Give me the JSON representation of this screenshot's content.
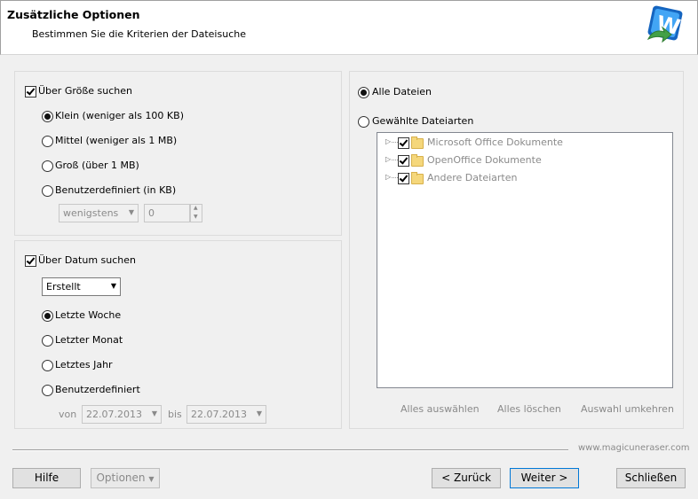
{
  "header": {
    "title": "Zusätzliche Optionen",
    "subtitle": "Bestimmen Sie die Kriterien der Dateisuche",
    "logo_icon": "magic-uneraser-logo-icon"
  },
  "size_group": {
    "checkbox_label": "Über Größe suchen",
    "checked": true,
    "options": [
      {
        "label": "Klein (weniger als 100 KB)",
        "selected": true
      },
      {
        "label": "Mittel (weniger als 1 MB)",
        "selected": false
      },
      {
        "label": "Groß (über 1 MB)",
        "selected": false
      },
      {
        "label": "Benutzerdefiniert (in KB)",
        "selected": false
      }
    ],
    "mode_select_value": "wenigstens",
    "size_value": "0"
  },
  "date_group": {
    "checkbox_label": "Über Datum suchen",
    "checked": true,
    "type_select_value": "Erstellt",
    "options": [
      {
        "label": "Letzte Woche",
        "selected": true
      },
      {
        "label": "Letzter Monat",
        "selected": false
      },
      {
        "label": "Letztes Jahr",
        "selected": false
      },
      {
        "label": "Benutzerdefiniert",
        "selected": false
      }
    ],
    "from_label": "von",
    "from_value": "22.07.2013",
    "to_label": "bis",
    "to_value": "22.07.2013"
  },
  "file_group": {
    "all_files_label": "Alle Dateien",
    "selected_types_label": "Gewählte Dateiarten",
    "tree_items": [
      {
        "label": "Microsoft Office Dokumente",
        "checked": true
      },
      {
        "label": "OpenOffice Dokumente",
        "checked": true
      },
      {
        "label": "Andere Dateiarten",
        "checked": true
      }
    ],
    "select_all_label": "Alles auswählen",
    "clear_all_label": "Alles löschen",
    "invert_label": "Auswahl umkehren"
  },
  "footer": {
    "website": "www.magicuneraser.com",
    "help_label": "Hilfe",
    "options_label": "Optionen",
    "back_label": "< Zurück",
    "next_label": "Weiter >",
    "close_label": "Schließen"
  }
}
